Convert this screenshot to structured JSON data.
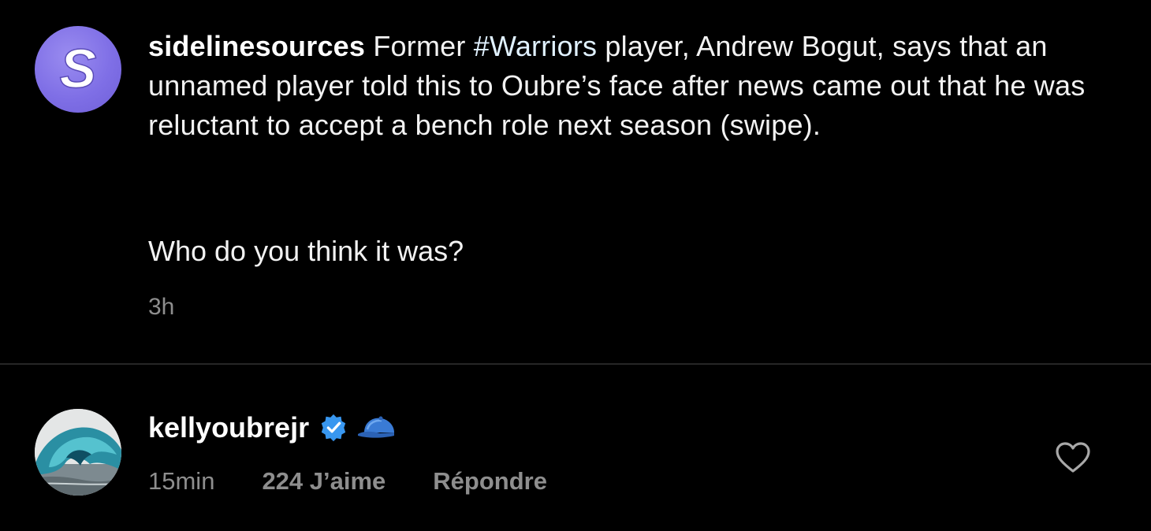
{
  "post": {
    "username": "sidelinesources",
    "caption_before_hashtag": "Former ",
    "hashtag": "#Warriors",
    "caption_after_hashtag": " player, Andrew Bogut, says that an unnamed player told this to Oubre’s face after news came out that he was reluctant to accept a bench role next season (swipe).",
    "question": "Who do you think it was?",
    "time": "3h",
    "avatar_letter": "S",
    "avatar_color": "#7f6fe6"
  },
  "comment": {
    "username": "kellyoubrejr",
    "verified_icon": "verified-badge-icon",
    "emoji_icon": "blue-cap-icon",
    "time": "15min",
    "likes": "224 J’aime",
    "reply_label": "Répondre",
    "like_icon": "heart-outline-icon",
    "verified_color": "#3897f0"
  }
}
